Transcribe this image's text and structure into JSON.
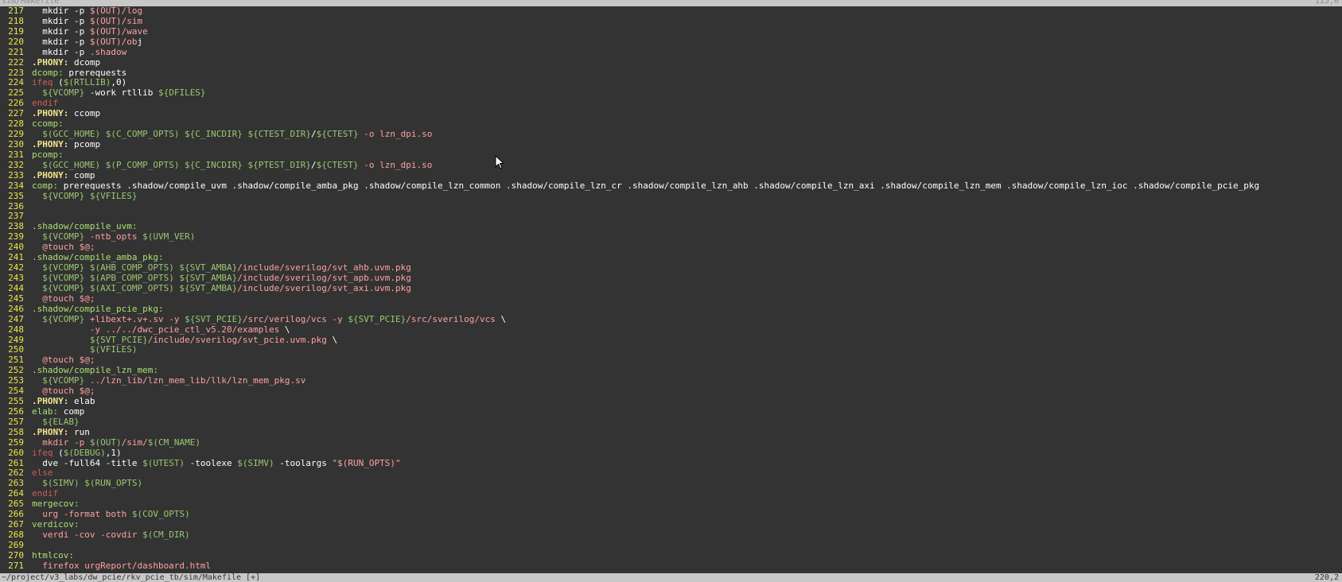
{
  "window": {
    "title_left": "sim/Makefile",
    "title_right": "115,0"
  },
  "status": {
    "filepath": "~/project/v3_labs/dw_pcie/rkv_pcie_tb/sim/Makefile [+]",
    "position": "220,2"
  },
  "lines": [
    {
      "n": "217",
      "segs": [
        [
          "plain",
          "  mkdir -p "
        ],
        [
          "str",
          "$(OUT)/log"
        ]
      ]
    },
    {
      "n": "218",
      "segs": [
        [
          "plain",
          "  mkdir -p "
        ],
        [
          "str",
          "$(OUT)/sim"
        ]
      ]
    },
    {
      "n": "219",
      "segs": [
        [
          "plain",
          "  mkdir -p "
        ],
        [
          "str",
          "$(OUT)/wave"
        ]
      ]
    },
    {
      "n": "220",
      "segs": [
        [
          "plain",
          "  mkdir -p "
        ],
        [
          "str",
          "$(OUT)/ob"
        ],
        [
          "cursor",
          "j"
        ]
      ]
    },
    {
      "n": "221",
      "segs": [
        [
          "plain",
          "  mkdir -p "
        ],
        [
          "str",
          ".shadow"
        ]
      ]
    },
    {
      "n": "222",
      "segs": [
        [
          "phony",
          ".PHONY:"
        ],
        [
          "plain",
          " dcomp"
        ]
      ]
    },
    {
      "n": "223",
      "segs": [
        [
          "target",
          "dcomp:"
        ],
        [
          "plain",
          " prerequests"
        ]
      ]
    },
    {
      "n": "224",
      "segs": [
        [
          "kw",
          "ifeq"
        ],
        [
          "plain",
          " ("
        ],
        [
          "var",
          "$(RTLLIB)"
        ],
        [
          "plain",
          ",0)"
        ]
      ]
    },
    {
      "n": "225",
      "segs": [
        [
          "plain",
          "  "
        ],
        [
          "var",
          "${VCOMP}"
        ],
        [
          "plain",
          " -work rtllib "
        ],
        [
          "var",
          "${DFILES}"
        ]
      ]
    },
    {
      "n": "226",
      "segs": [
        [
          "kw",
          "endif"
        ]
      ]
    },
    {
      "n": "227",
      "segs": [
        [
          "phony",
          ".PHONY:"
        ],
        [
          "plain",
          " ccomp"
        ]
      ]
    },
    {
      "n": "228",
      "segs": [
        [
          "target",
          "ccomp:"
        ]
      ]
    },
    {
      "n": "229",
      "segs": [
        [
          "plain",
          "  "
        ],
        [
          "var",
          "$(GCC_HOME) $(C_COMP_OPTS) ${C_INCDIR} ${CTEST_DIR}"
        ],
        [
          "plain",
          "/"
        ],
        [
          "var",
          "${CTEST}"
        ],
        [
          "plain",
          " "
        ],
        [
          "str",
          "-o lzn_dpi.so"
        ]
      ]
    },
    {
      "n": "230",
      "segs": [
        [
          "phony",
          ".PHONY:"
        ],
        [
          "plain",
          " pcomp"
        ]
      ]
    },
    {
      "n": "231",
      "segs": [
        [
          "target",
          "pcomp:"
        ]
      ]
    },
    {
      "n": "232",
      "segs": [
        [
          "plain",
          "  "
        ],
        [
          "var",
          "$(GCC_HOME) $(P_COMP_OPTS) ${C_INCDIR} ${PTEST_DIR}"
        ],
        [
          "plain",
          "/"
        ],
        [
          "var",
          "${CTEST}"
        ],
        [
          "plain",
          " "
        ],
        [
          "str",
          "-o lzn_dpi.so"
        ]
      ]
    },
    {
      "n": "233",
      "segs": [
        [
          "phony",
          ".PHONY:"
        ],
        [
          "plain",
          " comp"
        ]
      ]
    },
    {
      "n": "234",
      "segs": [
        [
          "target",
          "comp:"
        ],
        [
          "plain",
          " prerequests .shadow/compile_uvm .shadow/compile_amba_pkg .shadow/compile_lzn_common .shadow/compile_lzn_cr .shadow/compile_lzn_ahb .shadow/compile_lzn_axi .shadow/compile_lzn_mem .shadow/compile_lzn_ioc .shadow/compile_pcie_pkg"
        ]
      ]
    },
    {
      "n": "235",
      "segs": [
        [
          "plain",
          "  "
        ],
        [
          "var",
          "${VCOMP} ${VFILES}"
        ]
      ]
    },
    {
      "n": "236",
      "segs": []
    },
    {
      "n": "237",
      "segs": []
    },
    {
      "n": "238",
      "segs": [
        [
          "target",
          ".shadow/compile_uvm:"
        ]
      ]
    },
    {
      "n": "239",
      "segs": [
        [
          "plain",
          "  "
        ],
        [
          "var",
          "${VCOMP}"
        ],
        [
          "str",
          " -ntb_opts "
        ],
        [
          "var",
          "$(UVM_VER)"
        ]
      ]
    },
    {
      "n": "240",
      "segs": [
        [
          "str",
          "  @touch $@;"
        ]
      ]
    },
    {
      "n": "241",
      "segs": [
        [
          "target",
          ".shadow/compile_amba_pkg:"
        ]
      ]
    },
    {
      "n": "242",
      "segs": [
        [
          "plain",
          "  "
        ],
        [
          "var",
          "${VCOMP} $(AHB_COMP_OPTS) ${SVT_AMBA}"
        ],
        [
          "str",
          "/include/sverilog/svt_ahb.uvm.pkg"
        ]
      ]
    },
    {
      "n": "243",
      "segs": [
        [
          "plain",
          "  "
        ],
        [
          "var",
          "${VCOMP} $(APB_COMP_OPTS) ${SVT_AMBA}"
        ],
        [
          "str",
          "/include/sverilog/svt_apb.uvm.pkg"
        ]
      ]
    },
    {
      "n": "244",
      "segs": [
        [
          "plain",
          "  "
        ],
        [
          "var",
          "${VCOMP} $(AXI_COMP_OPTS) ${SVT_AMBA}"
        ],
        [
          "str",
          "/include/sverilog/svt_axi.uvm.pkg"
        ]
      ]
    },
    {
      "n": "245",
      "segs": [
        [
          "str",
          "  @touch $@;"
        ]
      ]
    },
    {
      "n": "246",
      "segs": [
        [
          "target",
          ".shadow/compile_pcie_pkg:"
        ]
      ]
    },
    {
      "n": "247",
      "segs": [
        [
          "plain",
          "  "
        ],
        [
          "var",
          "${VCOMP}"
        ],
        [
          "str",
          " +libext+.v+.sv -y "
        ],
        [
          "var",
          "${SVT_PCIE}"
        ],
        [
          "str",
          "/src/verilog/vcs -y "
        ],
        [
          "var",
          "${SVT_PCIE}"
        ],
        [
          "str",
          "/src/sverilog/vcs "
        ],
        [
          "plain",
          "\\"
        ]
      ]
    },
    {
      "n": "248",
      "segs": [
        [
          "str",
          "           -y ../../dwc_pcie_ctl_v5.20/examples "
        ],
        [
          "plain",
          "\\"
        ]
      ]
    },
    {
      "n": "249",
      "segs": [
        [
          "plain",
          "           "
        ],
        [
          "var",
          "${SVT_PCIE}"
        ],
        [
          "str",
          "/include/sverilog/svt_pcie.uvm.pkg "
        ],
        [
          "plain",
          "\\"
        ]
      ]
    },
    {
      "n": "250",
      "segs": [
        [
          "plain",
          "           "
        ],
        [
          "var",
          "$(VFILES)"
        ]
      ]
    },
    {
      "n": "251",
      "segs": [
        [
          "str",
          "  @touch $@;"
        ]
      ]
    },
    {
      "n": "252",
      "segs": [
        [
          "target",
          ".shadow/compile_lzn_mem:"
        ]
      ]
    },
    {
      "n": "253",
      "segs": [
        [
          "plain",
          "  "
        ],
        [
          "var",
          "${VCOMP}"
        ],
        [
          "str",
          " ../lzn_lib/lzn_mem_lib/llk/lzn_mem_pkg.sv"
        ]
      ]
    },
    {
      "n": "254",
      "segs": [
        [
          "str",
          "  @touch $@;"
        ]
      ]
    },
    {
      "n": "255",
      "segs": [
        [
          "phony",
          ".PHONY:"
        ],
        [
          "plain",
          " elab"
        ]
      ]
    },
    {
      "n": "256",
      "segs": [
        [
          "target",
          "elab:"
        ],
        [
          "plain",
          " comp"
        ]
      ]
    },
    {
      "n": "257",
      "segs": [
        [
          "plain",
          "  "
        ],
        [
          "var",
          "${ELAB}"
        ]
      ]
    },
    {
      "n": "258",
      "segs": [
        [
          "phony",
          ".PHONY:"
        ],
        [
          "plain",
          " run"
        ]
      ]
    },
    {
      "n": "259",
      "segs": [
        [
          "plain",
          "  "
        ],
        [
          "str",
          "mkdir -p "
        ],
        [
          "var",
          "$(OUT)"
        ],
        [
          "str",
          "/sim/"
        ],
        [
          "var",
          "$(CM_NAME)"
        ]
      ]
    },
    {
      "n": "260",
      "segs": [
        [
          "kw",
          "ifeq"
        ],
        [
          "plain",
          " ("
        ],
        [
          "var",
          "$(DEBUG)"
        ],
        [
          "plain",
          ",1)"
        ]
      ]
    },
    {
      "n": "261",
      "segs": [
        [
          "plain",
          "  dve -full64 -title "
        ],
        [
          "var",
          "$(UTEST)"
        ],
        [
          "plain",
          " -toolexe "
        ],
        [
          "var",
          "$(SIMV)"
        ],
        [
          "plain",
          " -toolargs "
        ],
        [
          "str",
          "\"$(RUN_OPTS)\""
        ]
      ]
    },
    {
      "n": "262",
      "segs": [
        [
          "kw",
          "else"
        ]
      ]
    },
    {
      "n": "263",
      "segs": [
        [
          "plain",
          "  "
        ],
        [
          "var",
          "$(SIMV) $(RUN_OPTS)"
        ]
      ]
    },
    {
      "n": "264",
      "segs": [
        [
          "kw",
          "endif"
        ]
      ]
    },
    {
      "n": "265",
      "segs": [
        [
          "target",
          "mergecov:"
        ]
      ]
    },
    {
      "n": "266",
      "segs": [
        [
          "str",
          "  urg -format both "
        ],
        [
          "var",
          "$(COV_OPTS)"
        ]
      ]
    },
    {
      "n": "267",
      "segs": [
        [
          "target",
          "verdicov:"
        ]
      ]
    },
    {
      "n": "268",
      "segs": [
        [
          "str",
          "  verdi -cov -covdir "
        ],
        [
          "var",
          "$(CM_DIR)"
        ]
      ]
    },
    {
      "n": "269",
      "segs": []
    },
    {
      "n": "270",
      "segs": [
        [
          "target",
          "htmlcov:"
        ]
      ]
    },
    {
      "n": "271",
      "segs": [
        [
          "str",
          "  firefox urgReport/dashboard.html"
        ]
      ]
    }
  ]
}
